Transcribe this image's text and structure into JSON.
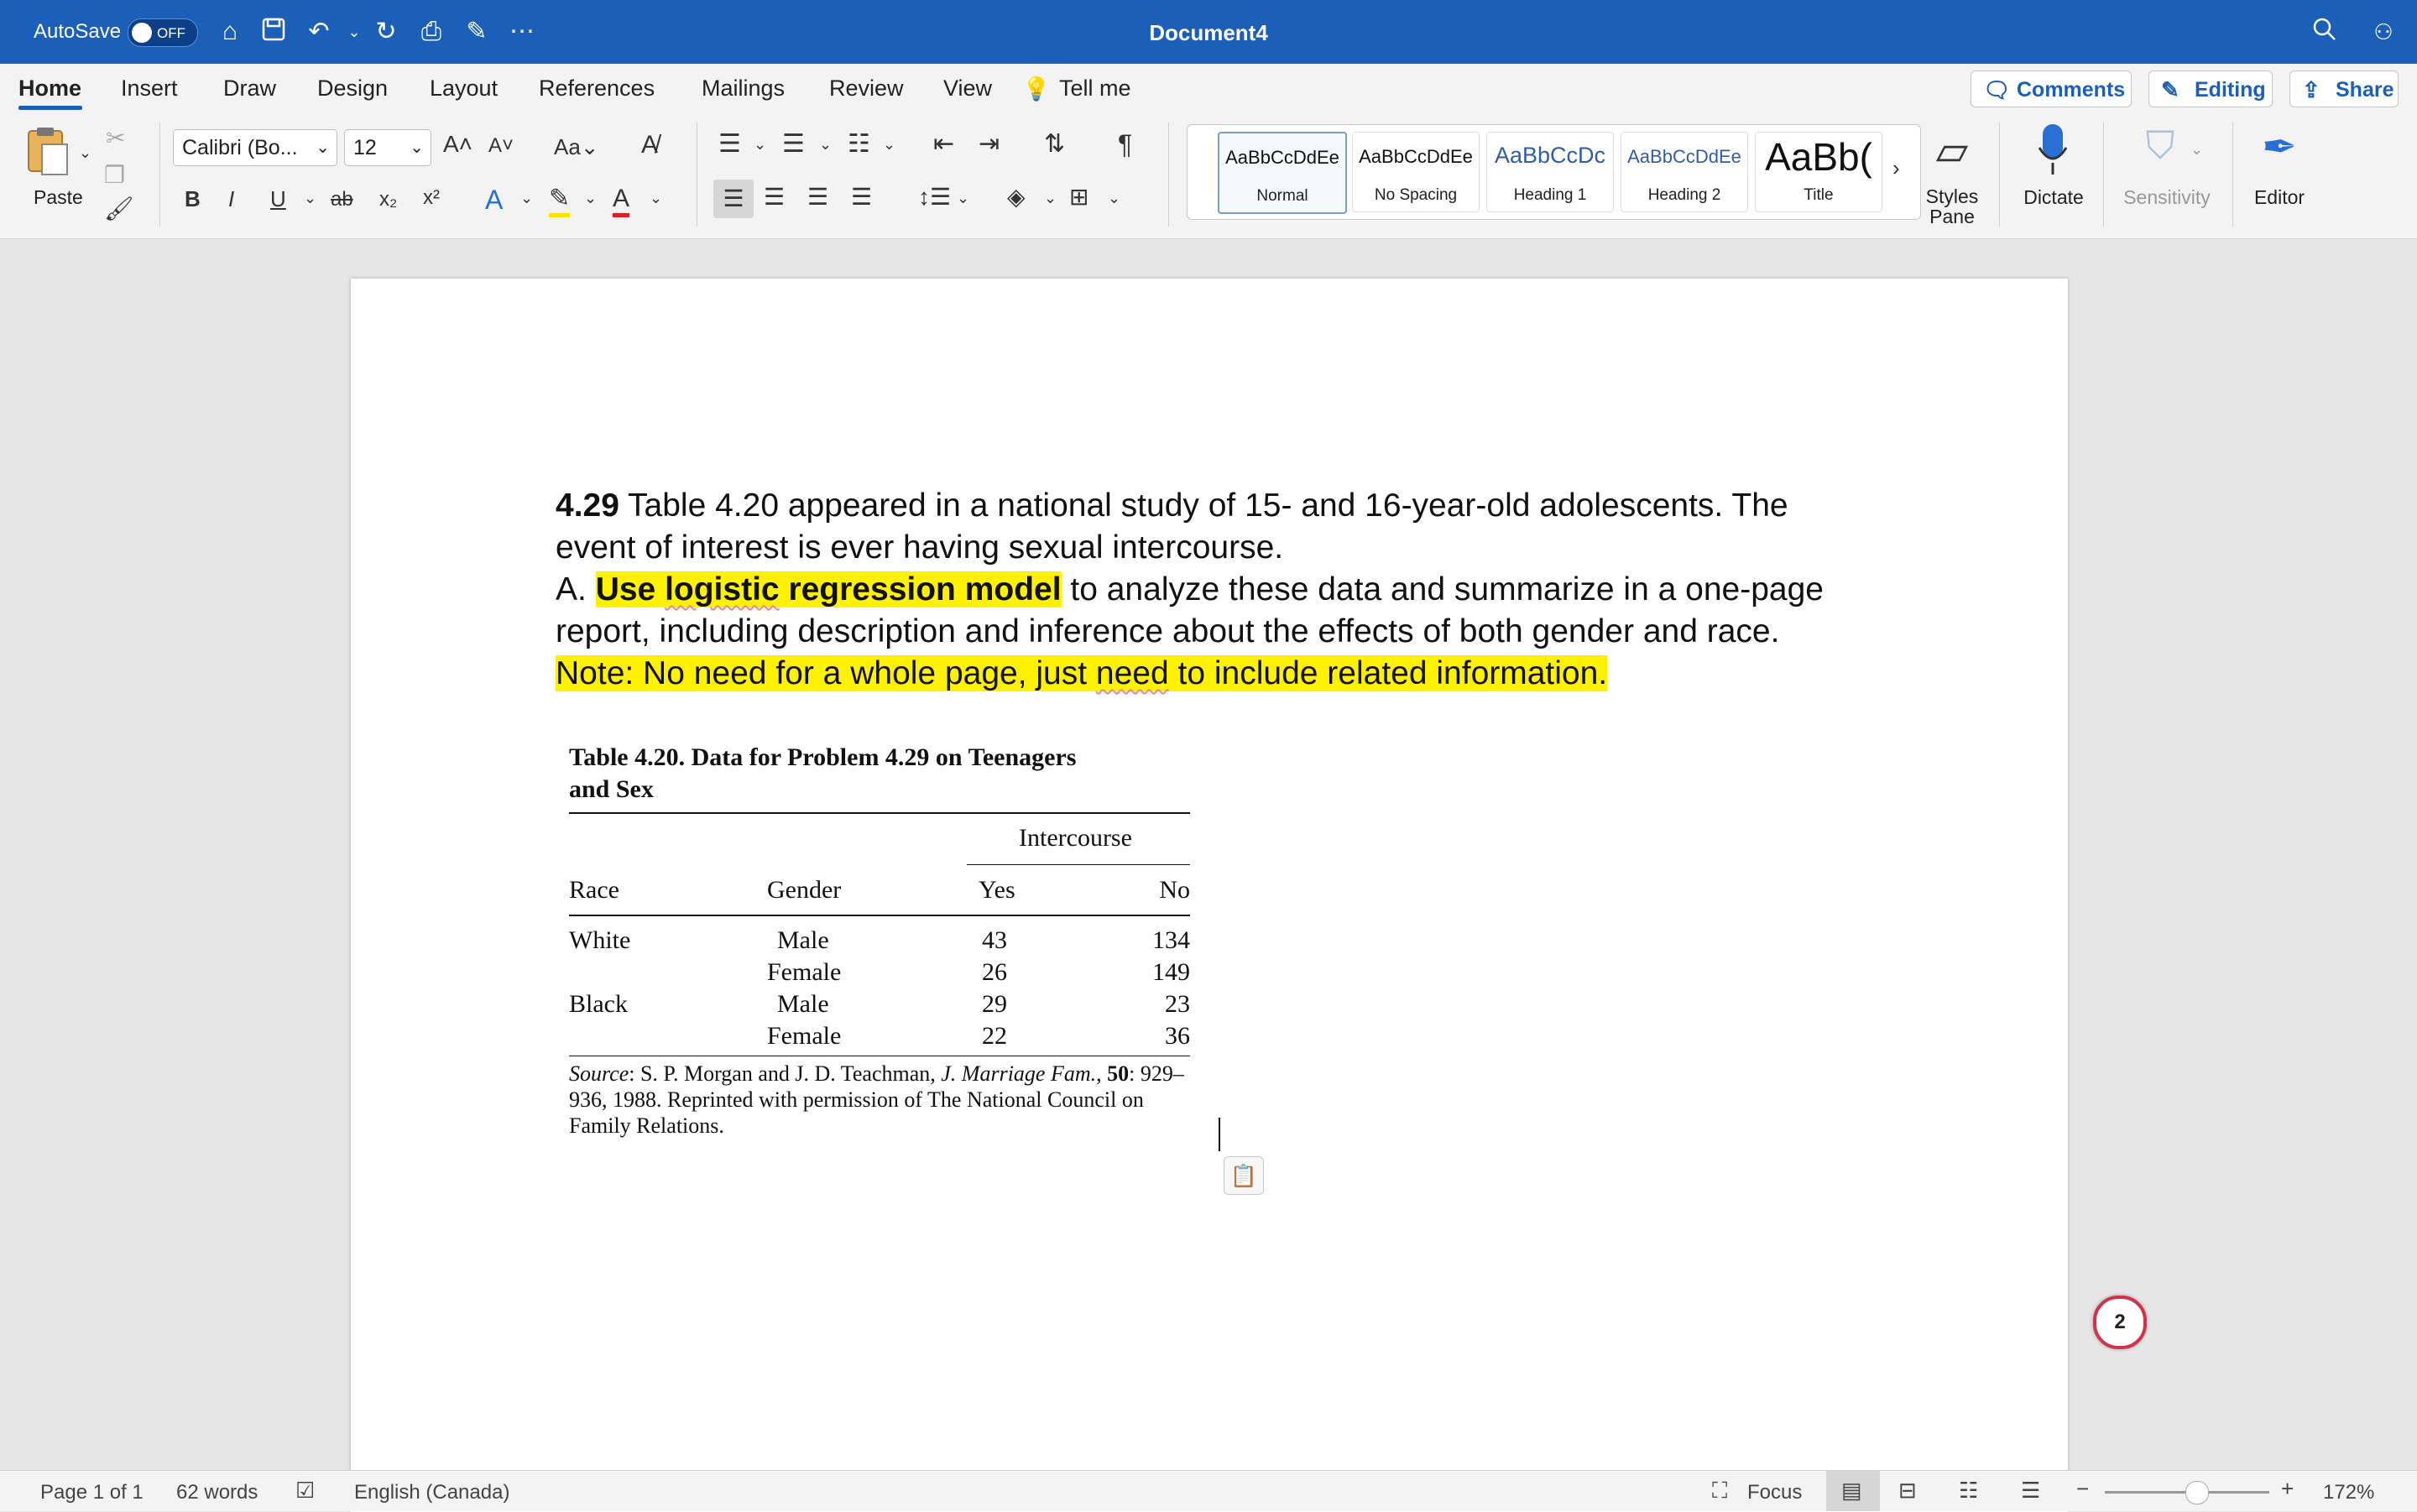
{
  "titlebar": {
    "autosave_label": "AutoSave",
    "autosave_state": "OFF",
    "document_title": "Document4"
  },
  "tabs": [
    "Home",
    "Insert",
    "Draw",
    "Design",
    "Layout",
    "References",
    "Mailings",
    "Review",
    "View"
  ],
  "tell_me": "Tell me",
  "right_buttons": {
    "comments": "Comments",
    "editing": "Editing",
    "share": "Share"
  },
  "ribbon": {
    "paste_label": "Paste",
    "font_name": "Calibri (Bo...",
    "font_size": "12",
    "styles": [
      {
        "preview": "AaBbCcDdEe",
        "name": "Normal"
      },
      {
        "preview": "AaBbCcDdEe",
        "name": "No Spacing"
      },
      {
        "preview": "AaBbCcDc",
        "name": "Heading 1"
      },
      {
        "preview": "AaBbCcDdEe",
        "name": "Heading 2"
      },
      {
        "preview": "AaBb(",
        "name": "Title"
      }
    ],
    "styles_pane_line1": "Styles",
    "styles_pane_line2": "Pane",
    "dictate": "Dictate",
    "sensitivity": "Sensitivity",
    "editor": "Editor"
  },
  "document": {
    "problem_number": "4.29",
    "line1": " Table 4.20 appeared in a national study of 15- and 16-year-old adolescents. The event of interest is ever having sexual intercourse.",
    "part_a_prefix": "A. ",
    "part_a_bold": "Use ",
    "part_a_bold_squig": "logistic",
    "part_a_bold_rest": " regression model",
    "part_a_rest": " to analyze these data and summarize in a one-page report, including description and inference about the effects of both gender and race. ",
    "note_1": "Note: No need for a whole page, just ",
    "note_squig": "need",
    "note_2": " to include related information.",
    "table": {
      "caption": "Table  4.20.  Data for Problem 4.29 on Teenagers and Sex",
      "group_header": "Intercourse",
      "columns": [
        "Race",
        "Gender",
        "Yes",
        "No"
      ],
      "rows": [
        {
          "race": "White",
          "gender": "Male",
          "yes": "43",
          "no": "134"
        },
        {
          "race": "",
          "gender": "Female",
          "yes": "26",
          "no": "149"
        },
        {
          "race": "Black",
          "gender": "Male",
          "yes": "29",
          "no": "23"
        },
        {
          "race": "",
          "gender": "Female",
          "yes": "22",
          "no": "36"
        }
      ],
      "source_label": "Source",
      "source_text_1": ":  S. P. Morgan and J. D. Teachman, ",
      "source_journal": "J. Marriage Fam.",
      "source_text_2": ", ",
      "source_volume": "50",
      "source_text_3": ": 929–936, 1988. Reprinted with permission of The National Council on Family Relations."
    }
  },
  "comment_count": "2",
  "statusbar": {
    "page": "Page 1 of 1",
    "words": "62 words",
    "language": "English (Canada)",
    "focus": "Focus",
    "zoom": "172%"
  }
}
